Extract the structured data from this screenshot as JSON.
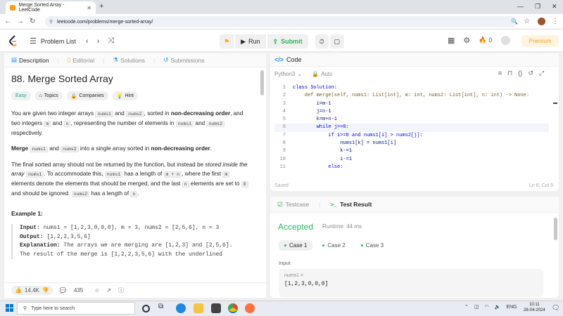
{
  "browser": {
    "tab_title": "Merge Sorted Array - LeetCode",
    "url": "leetcode.com/problems/merge-sorted-array/"
  },
  "header": {
    "problem_list": "Problem List",
    "run_label": "Run",
    "submit_label": "Submit",
    "fire_count": "0",
    "premium_label": "Premium"
  },
  "left_tabs": [
    "Description",
    "Editorial",
    "Solutions",
    "Submissions"
  ],
  "problem": {
    "title": "88. Merge Sorted Array",
    "difficulty": "Easy",
    "chips": [
      "Topics",
      "Companies",
      "Hint"
    ],
    "p1": {
      "a": "You are given two integer arrays ",
      "c1": "nums1",
      "b": " and ",
      "c2": "nums2",
      "d": ", sorted in ",
      "bold": "non-decreasing order",
      "e": ", and two integers ",
      "c3": "m",
      "f": " and ",
      "c4": "n",
      "g": ", representing the number of elements in ",
      "c5": "nums1",
      "h": " and ",
      "c6": "nums2",
      "i": " respectively."
    },
    "p2": {
      "bold1": "Merge",
      "c1": "nums1",
      "a": " and ",
      "c2": "nums2",
      "b": " into a single array sorted in ",
      "bold2": "non-decreasing order",
      "c": "."
    },
    "p3": {
      "a": "The final sorted array should not be returned by the function, but instead be ",
      "ital": "stored inside the array",
      "c1": "nums1",
      "b": ". To accommodate this, ",
      "c2": "nums1",
      "c": " has a length of ",
      "c3": "m + n",
      "d": ", where the first ",
      "c4": "m",
      "e": " elements denote the elements that should be merged, and the last ",
      "c5": "n",
      "f": " elements are set to ",
      "c6": "0",
      "g": " and should be ignored. ",
      "c7": "nums2",
      "h": " has a length of ",
      "c8": "n",
      "i": "."
    },
    "example_heading": "Example 1:",
    "example": {
      "input_label": "Input:",
      "input_value": " nums1 = [1,2,3,0,0,0], m = 3, nums2 = [2,5,6], n = 3",
      "output_label": "Output:",
      "output_value": " [1,2,2,3,5,6]",
      "explanation_label": "Explanation:",
      "explanation_value": " The arrays we are merging are [1,2,3] and [2,5,6].",
      "cut_line": "The result of the merge is [1,2,2,3,5,6] with the underlined"
    }
  },
  "bottom_bar": {
    "likes": "14.4K",
    "comments": "435"
  },
  "editor": {
    "title": "Code",
    "language": "Python3",
    "autosave": "Auto",
    "status_left": "Saved",
    "status_right": "Ln 6, Col 9",
    "lines": [
      "class Solution:",
      "    def merge(self, nums1: List[int], m: int, nums2: List[int], n: int) -> None:",
      "        i=m-1",
      "        j=n-1",
      "        k=m+n-1",
      "        while j>=0:",
      "            if i>=0 and nums1[i] > nums2[j]:",
      "                nums1[k] = nums1[i]",
      "                k-=1",
      "                i-=1",
      "            else:"
    ],
    "line_numbers": [
      "1",
      "2",
      "3",
      "4",
      "5",
      "6",
      "7",
      "8",
      "9",
      "10",
      "11"
    ]
  },
  "results": {
    "tabs": [
      "Testcase",
      "Test Result"
    ],
    "status": "Accepted",
    "runtime": "Runtime: 44 ms",
    "cases": [
      "Case 1",
      "Case 2",
      "Case 3"
    ],
    "input_label": "Input",
    "input_name": "nums1 =",
    "input_value": "[1,2,3,0,0,0]"
  },
  "taskbar": {
    "search_placeholder": "Type here to search",
    "lang": "ENG",
    "time": "10:11",
    "date": "28-04-2024"
  }
}
